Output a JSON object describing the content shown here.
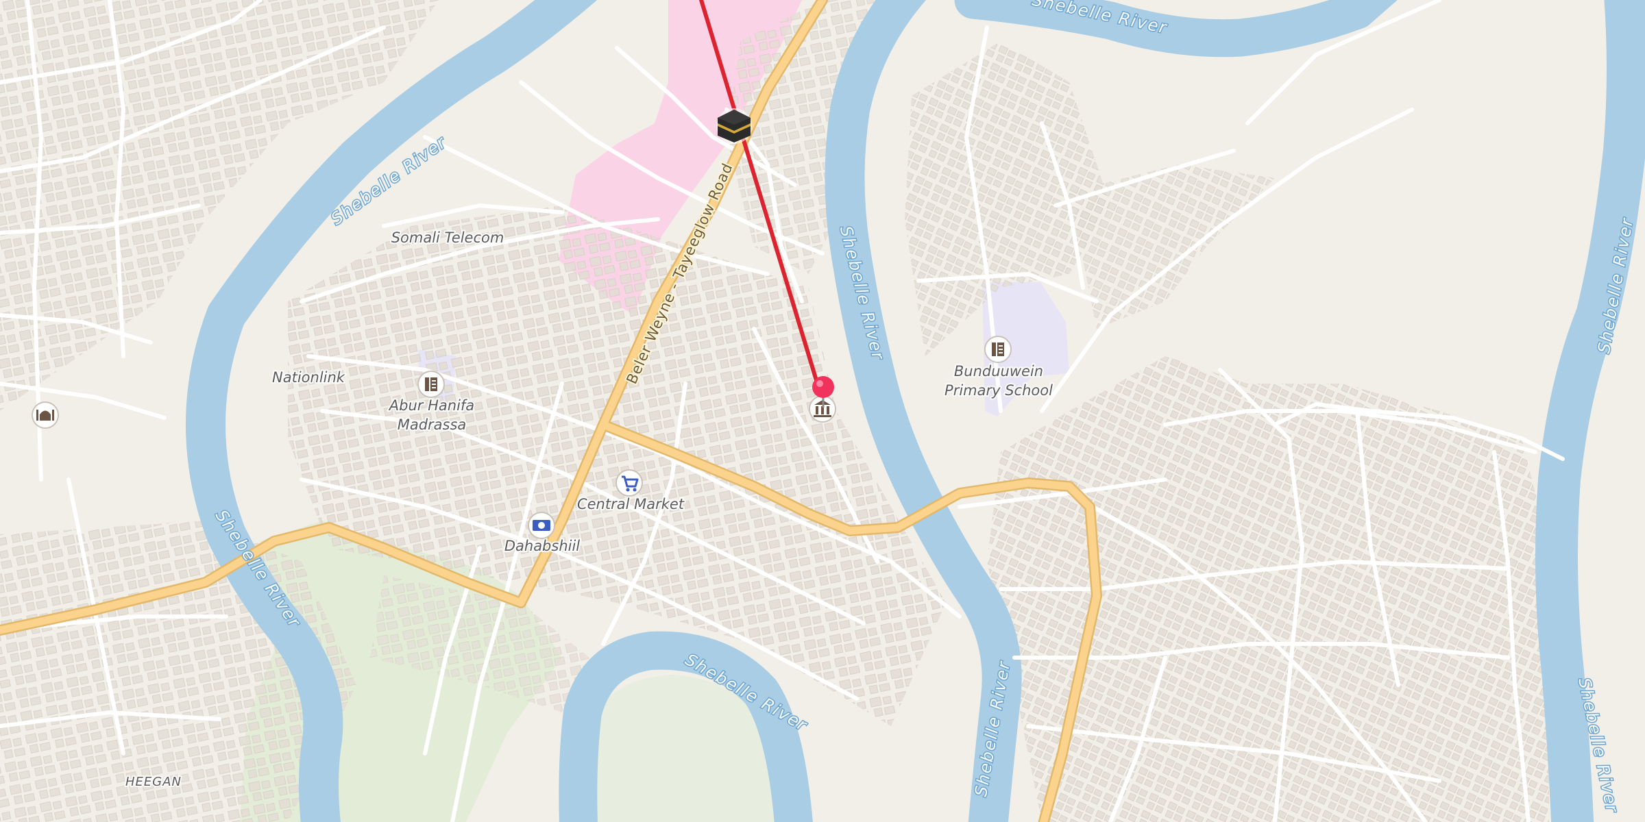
{
  "map": {
    "colors": {
      "land": "#f2efe9",
      "water": "#a9cde4",
      "minor_road": "#ffffff",
      "main_road_fill": "#fbd38c",
      "main_road_casing": "#e3b86b",
      "building": "#e3ddd5",
      "hospital_area": "#fbd3e6",
      "school_area": "#e7e4f6",
      "park_area": "#e3ecd7",
      "route_line": "#dc2430",
      "pin": "#f0325c"
    },
    "labels": {
      "somali_telecom": "Somali Telecom",
      "nationlink": "Nationlink",
      "abur_hanifa_1": "Abur Hanifa",
      "abur_hanifa_2": "Madrassa",
      "central_market": "Central Market",
      "dahabshiil": "Dahabshiil",
      "bunduuwein_1": "Bunduuwein",
      "bunduuwein_2": "Primary School",
      "heegan": "HEEGAN",
      "river": "Shebelle River",
      "road": "Beler Weyne - Tayeeglow Road"
    },
    "icons": {
      "kaaba": "kaaba-icon",
      "pin": "location-pin-icon",
      "museum": "museum-icon",
      "mosque": "mosque-icon",
      "school": "school-icon",
      "market": "shopping-cart-icon",
      "bank": "banknote-icon"
    }
  }
}
